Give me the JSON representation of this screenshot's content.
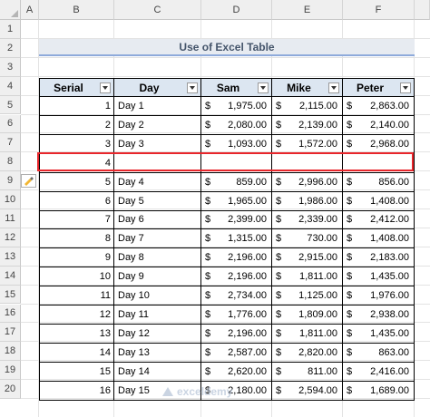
{
  "columns": [
    "A",
    "B",
    "C",
    "D",
    "E",
    "F"
  ],
  "rows": [
    "1",
    "2",
    "3",
    "4",
    "5",
    "6",
    "7",
    "8",
    "9",
    "10",
    "11",
    "12",
    "13",
    "14",
    "15",
    "16",
    "17",
    "18",
    "19",
    "20"
  ],
  "title": "Use of Excel Table",
  "headers": [
    "Serial",
    "Day",
    "Sam",
    "Mike",
    "Peter"
  ],
  "currency": "$",
  "table": [
    {
      "serial": "1",
      "day": "Day 1",
      "sam": "1,975.00",
      "mike": "2,115.00",
      "peter": "2,863.00"
    },
    {
      "serial": "2",
      "day": "Day 2",
      "sam": "2,080.00",
      "mike": "2,139.00",
      "peter": "2,140.00"
    },
    {
      "serial": "3",
      "day": "Day 3",
      "sam": "1,093.00",
      "mike": "1,572.00",
      "peter": "2,968.00"
    },
    {
      "serial": "4",
      "day": "",
      "sam": "",
      "mike": "",
      "peter": ""
    },
    {
      "serial": "5",
      "day": "Day 4",
      "sam": "859.00",
      "mike": "2,996.00",
      "peter": "856.00"
    },
    {
      "serial": "6",
      "day": "Day 5",
      "sam": "1,965.00",
      "mike": "1,986.00",
      "peter": "1,408.00"
    },
    {
      "serial": "7",
      "day": "Day 6",
      "sam": "2,399.00",
      "mike": "2,339.00",
      "peter": "2,412.00"
    },
    {
      "serial": "8",
      "day": "Day 7",
      "sam": "1,315.00",
      "mike": "730.00",
      "peter": "1,408.00"
    },
    {
      "serial": "9",
      "day": "Day 8",
      "sam": "2,196.00",
      "mike": "2,915.00",
      "peter": "2,183.00"
    },
    {
      "serial": "10",
      "day": "Day 9",
      "sam": "2,196.00",
      "mike": "1,811.00",
      "peter": "1,435.00"
    },
    {
      "serial": "11",
      "day": "Day 10",
      "sam": "2,734.00",
      "mike": "1,125.00",
      "peter": "1,976.00"
    },
    {
      "serial": "12",
      "day": "Day 11",
      "sam": "1,776.00",
      "mike": "1,809.00",
      "peter": "2,938.00"
    },
    {
      "serial": "13",
      "day": "Day 12",
      "sam": "2,196.00",
      "mike": "1,811.00",
      "peter": "1,435.00"
    },
    {
      "serial": "14",
      "day": "Day 13",
      "sam": "2,587.00",
      "mike": "2,820.00",
      "peter": "863.00"
    },
    {
      "serial": "15",
      "day": "Day 14",
      "sam": "2,620.00",
      "mike": "811.00",
      "peter": "2,416.00"
    },
    {
      "serial": "16",
      "day": "Day 15",
      "sam": "2,180.00",
      "mike": "2,594.00",
      "peter": "1,689.00"
    }
  ],
  "watermark": "exceldemy",
  "colors": {
    "header_fill": "#dce6f1",
    "title_fill": "#e7ebf1",
    "highlight": "#e8262b",
    "title_text": "#44546a"
  }
}
